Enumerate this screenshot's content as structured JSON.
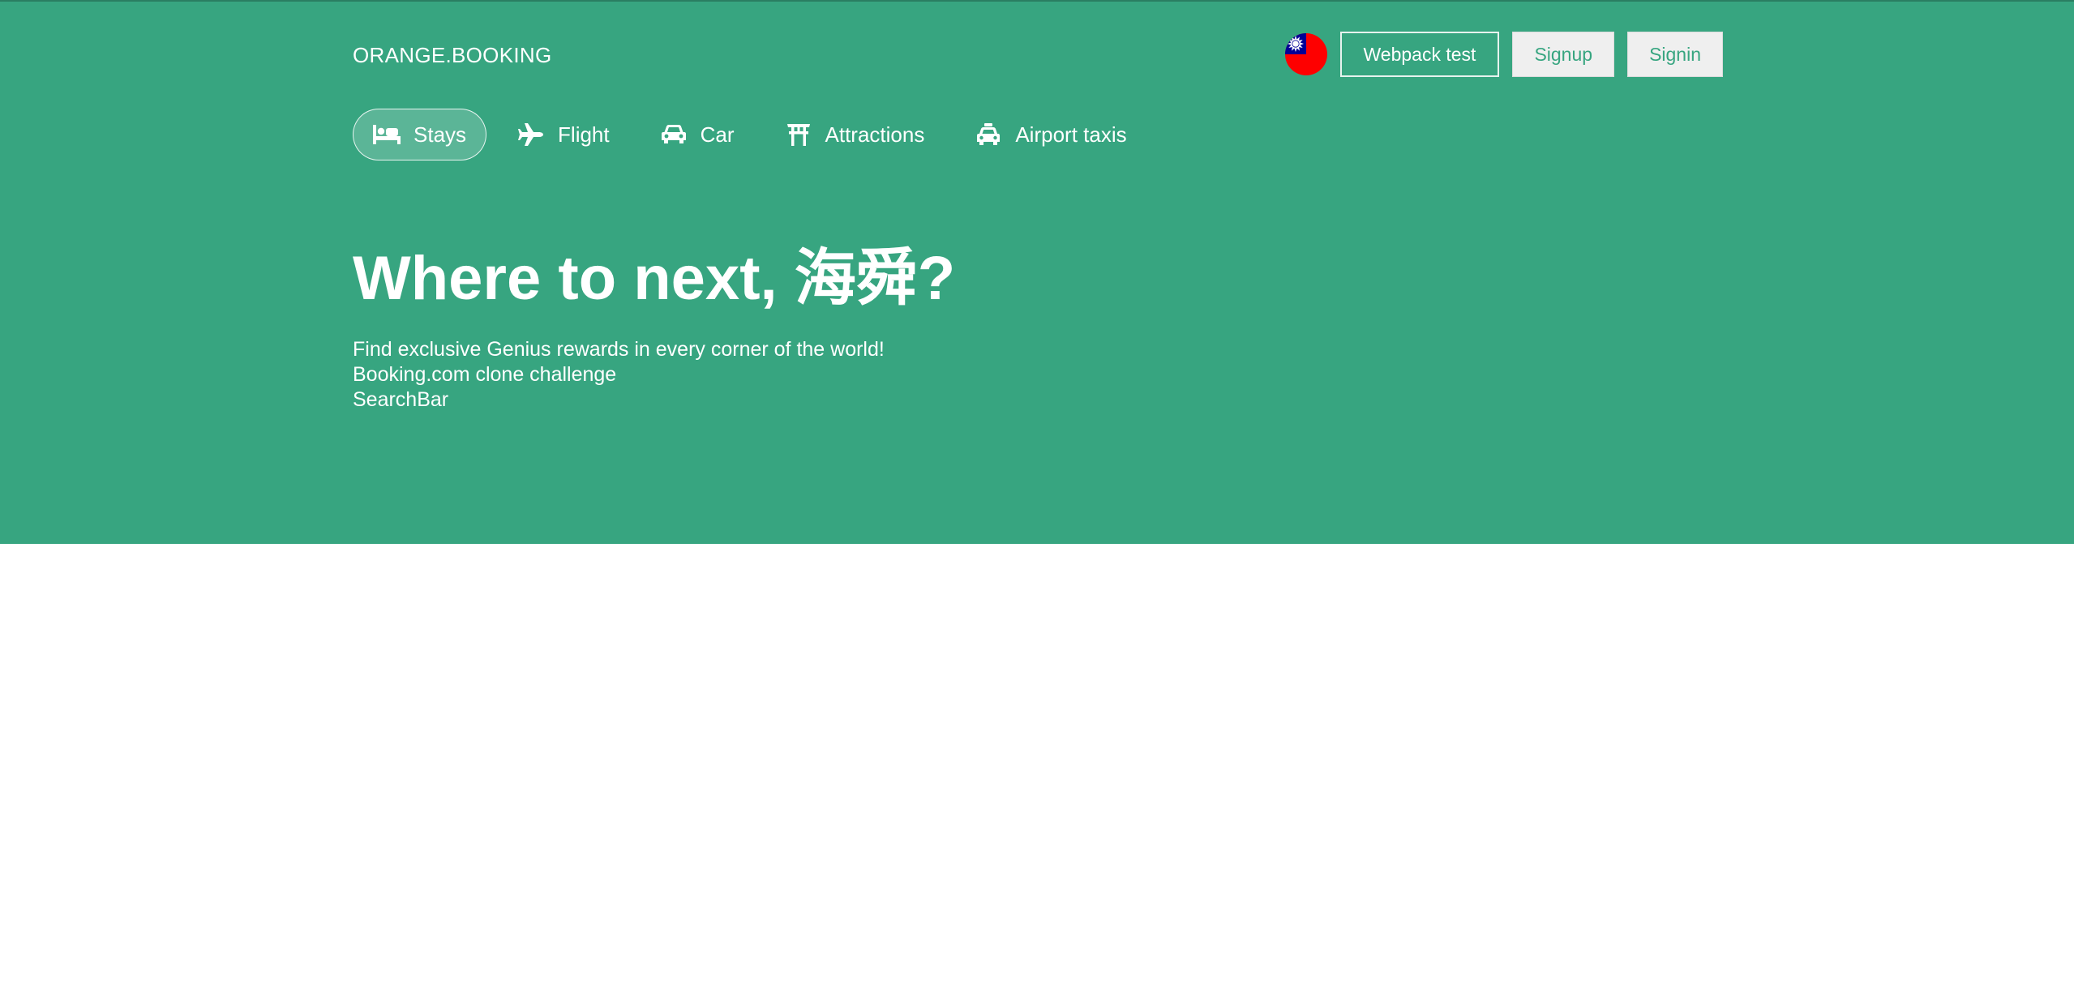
{
  "header": {
    "logo": "ORANGE.BOOKING",
    "flag_icon": "taiwan-flag-icon",
    "buttons": {
      "webpack": "Webpack test",
      "signup": "Signup",
      "signin": "Signin"
    }
  },
  "nav": {
    "items": [
      {
        "label": "Stays",
        "icon": "bed-icon",
        "active": true
      },
      {
        "label": "Flight",
        "icon": "plane-icon",
        "active": false
      },
      {
        "label": "Car",
        "icon": "car-icon",
        "active": false
      },
      {
        "label": "Attractions",
        "icon": "torii-gate-icon",
        "active": false
      },
      {
        "label": "Airport taxis",
        "icon": "taxi-icon",
        "active": false
      }
    ]
  },
  "hero": {
    "title": "Where to next, 海舜?",
    "lines": [
      "Find exclusive Genius rewards in every corner of the world!",
      "Booking.com clone challenge",
      "SearchBar"
    ]
  },
  "colors": {
    "brand": "#37a580",
    "text_on_brand": "#ffffff",
    "button_light_bg": "#efefef"
  }
}
